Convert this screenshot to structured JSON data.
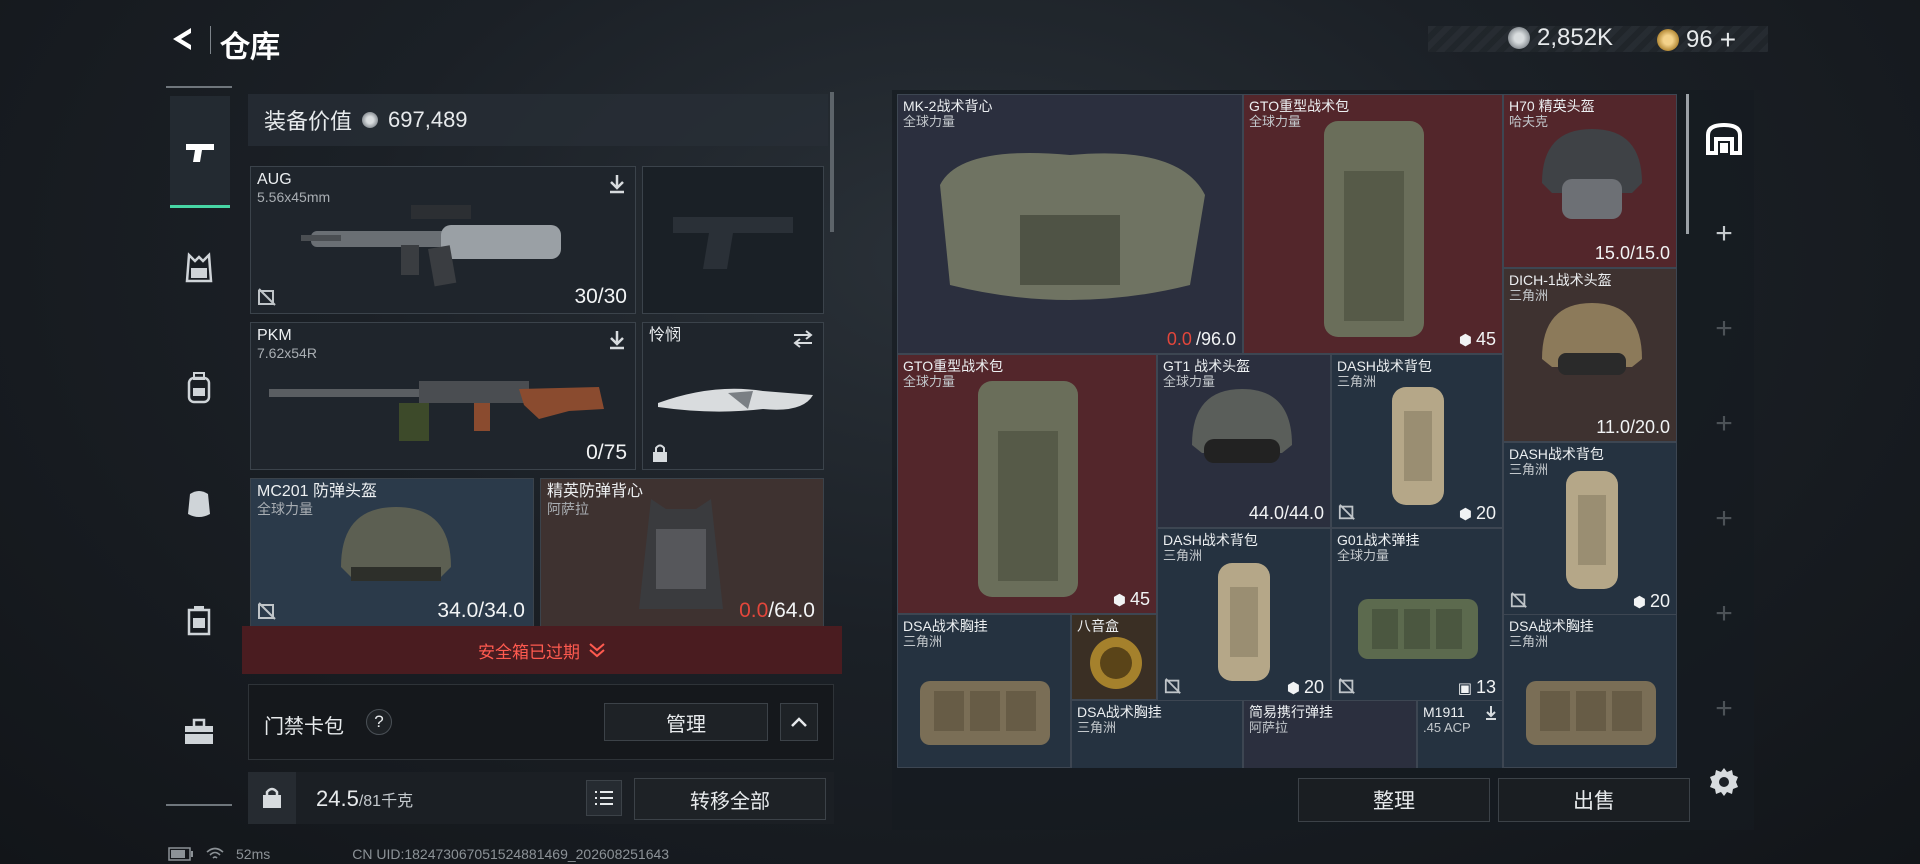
{
  "header": {
    "back_icon": "back-arrow-icon",
    "title": "仓库",
    "currency1_value": "2,852K",
    "currency2_value": "96",
    "currency2_add": "+"
  },
  "nav": {
    "items": [
      "pistol-icon",
      "vest-icon",
      "backpack-icon",
      "armor-icon",
      "pouch-icon",
      "toolbox-icon"
    ]
  },
  "equipment": {
    "value_label": "装备价值",
    "value": "697,489",
    "slots": {
      "primary": {
        "name": "AUG",
        "sub": "5.56x45mm",
        "count": "30/30"
      },
      "sidearm": {
        "name": ""
      },
      "secondary": {
        "name": "PKM",
        "sub": "7.62x54R",
        "count": "0/75"
      },
      "melee": {
        "name": "怜悯"
      },
      "helmet": {
        "name": "MC201 防弹头盔",
        "sub": "全球力量",
        "count": "34.0/34.0"
      },
      "armor": {
        "name": "精英防弹背心",
        "sub": "阿萨拉",
        "count_red": "0.0",
        "count_rest": "/64.0"
      }
    }
  },
  "safebox": {
    "expired_text": "安全箱已过期"
  },
  "cardpack": {
    "label": "门禁卡包",
    "help": "?",
    "manage": "管理",
    "collapse": "^"
  },
  "weight": {
    "current": "24.5",
    "max": "/81千克"
  },
  "actions": {
    "transfer_all": "转移全部",
    "sort": "整理",
    "sell": "出售"
  },
  "status_bar": {
    "ping": "52ms",
    "uid": "CN UID:1824730670515248814​69_202608251643"
  },
  "stash": {
    "items": [
      {
        "id": "mk2",
        "name": "MK-2战术背心",
        "sub": "全球力量",
        "count_red": "0.0",
        "count_rest": "/96.0"
      },
      {
        "id": "gto1",
        "name": "GTO重型战术包",
        "sub": "全球力量",
        "count": "45"
      },
      {
        "id": "h70",
        "name": "H70 精英头盔",
        "sub": "哈夫克",
        "count": "15.0/15.0"
      },
      {
        "id": "dich",
        "name": "DICH-1战术头盔",
        "sub": "三角洲",
        "count": "11.0/20.0"
      },
      {
        "id": "gto2",
        "name": "GTO重型战术包",
        "sub": "全球力量",
        "count": "45"
      },
      {
        "id": "gt1",
        "name": "GT1 战术头盔",
        "sub": "全球力量",
        "count": "44.0/44.0"
      },
      {
        "id": "dash1",
        "name": "DASH战术背包",
        "sub": "三角洲",
        "count": "20"
      },
      {
        "id": "dash2",
        "name": "DASH战术背包",
        "sub": "三角洲",
        "count": "20"
      },
      {
        "id": "dash3",
        "name": "DASH战术背包",
        "sub": "三角洲",
        "count": "20"
      },
      {
        "id": "g01",
        "name": "G01战术弹挂",
        "sub": "全球力量",
        "count": "13"
      },
      {
        "id": "dsa1",
        "name": "DSA战术胸挂",
        "sub": "三角洲"
      },
      {
        "id": "bagua",
        "name": "八音盒"
      },
      {
        "id": "dsa2",
        "name": "DSA战术胸挂",
        "sub": "三角洲"
      },
      {
        "id": "dsa3",
        "name": "DSA战术胸挂",
        "sub": "三角洲"
      },
      {
        "id": "simple",
        "name": "简易携行弹挂",
        "sub": "阿萨拉"
      },
      {
        "id": "m1911",
        "name": "M1911",
        "sub": ".45 ACP"
      }
    ]
  },
  "colors": {
    "accent_red": "#e2463b",
    "panel_blue": "#2b3a4a",
    "panel_red": "#53262b"
  }
}
